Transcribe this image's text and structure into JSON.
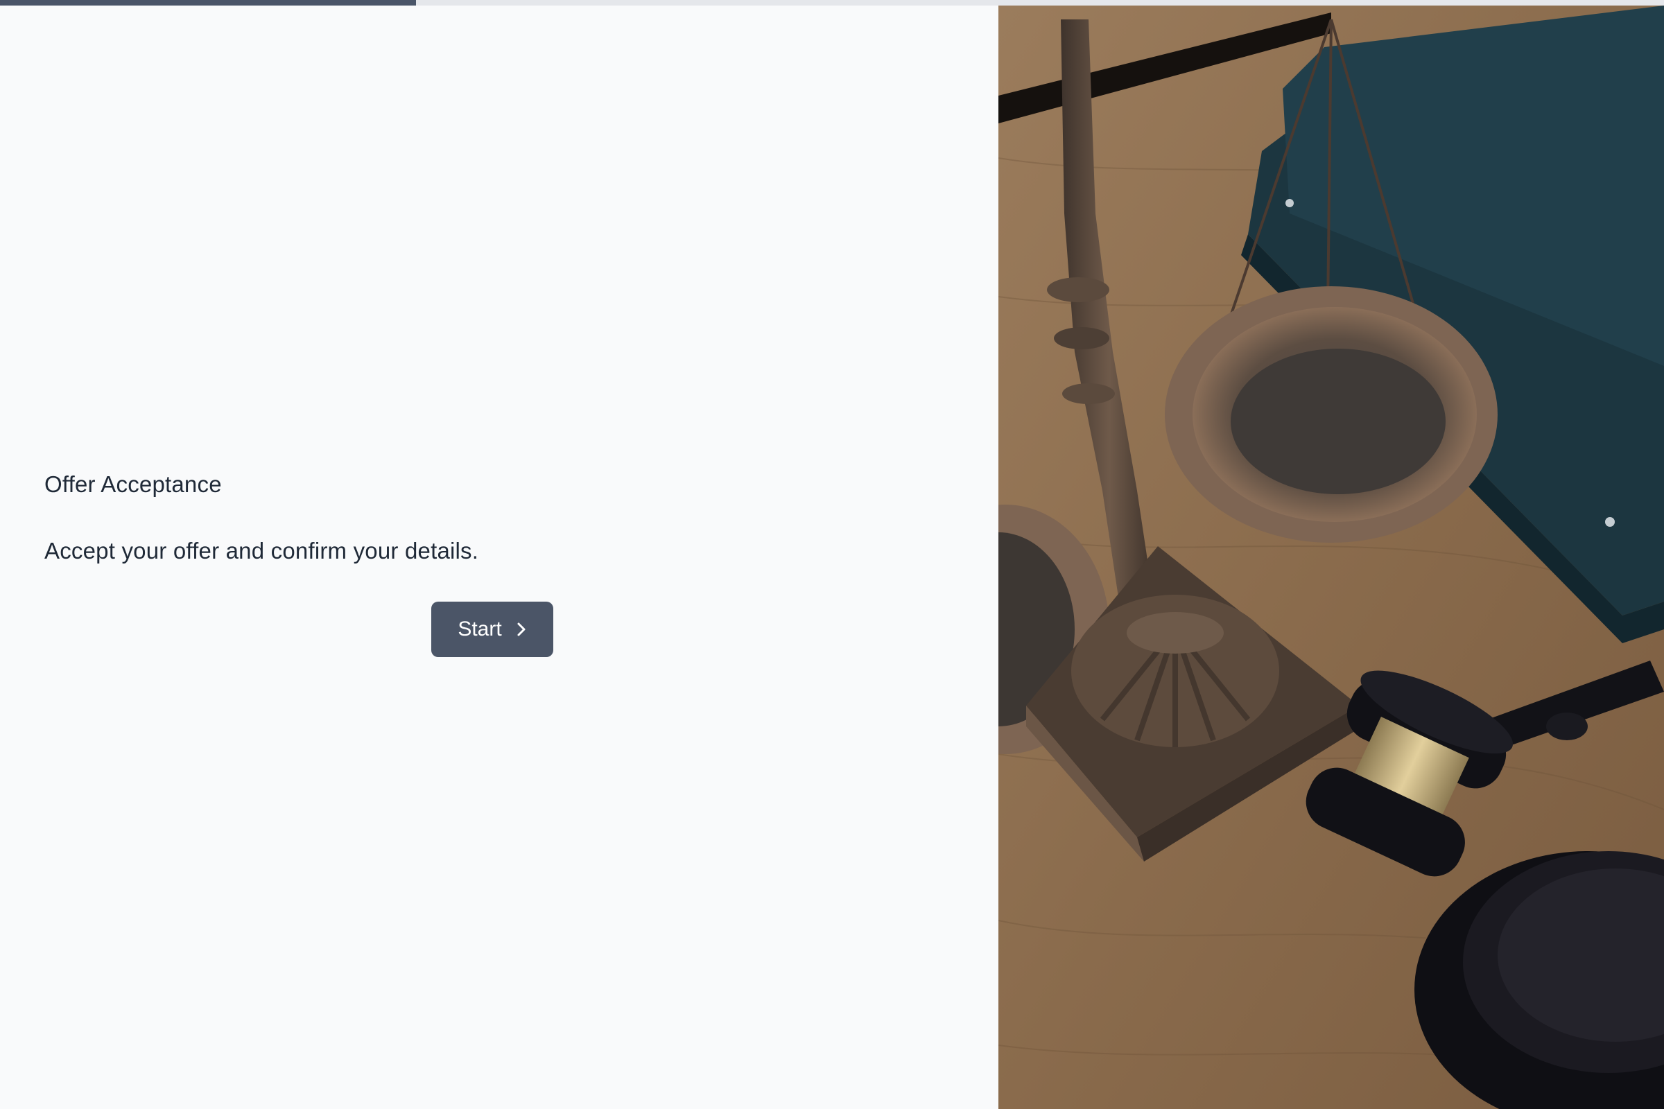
{
  "progress": {
    "fraction": 0.25,
    "fill_color": "#4a5568",
    "track_color": "#e5e7eb"
  },
  "intro": {
    "title": "Offer Acceptance",
    "subtitle": "Accept your offer and confirm your details.",
    "start_label": "Start",
    "start_icon": "chevron-right-icon",
    "button_color": "#4b5567"
  },
  "hero_image": {
    "subject": "scales-and-gavel-photo",
    "palette": {
      "wood": "#8a6a4a",
      "binder": "#1f3a44",
      "bronze": "#6b5646",
      "gavel": "#121217",
      "brass": "#c9b07a"
    }
  }
}
